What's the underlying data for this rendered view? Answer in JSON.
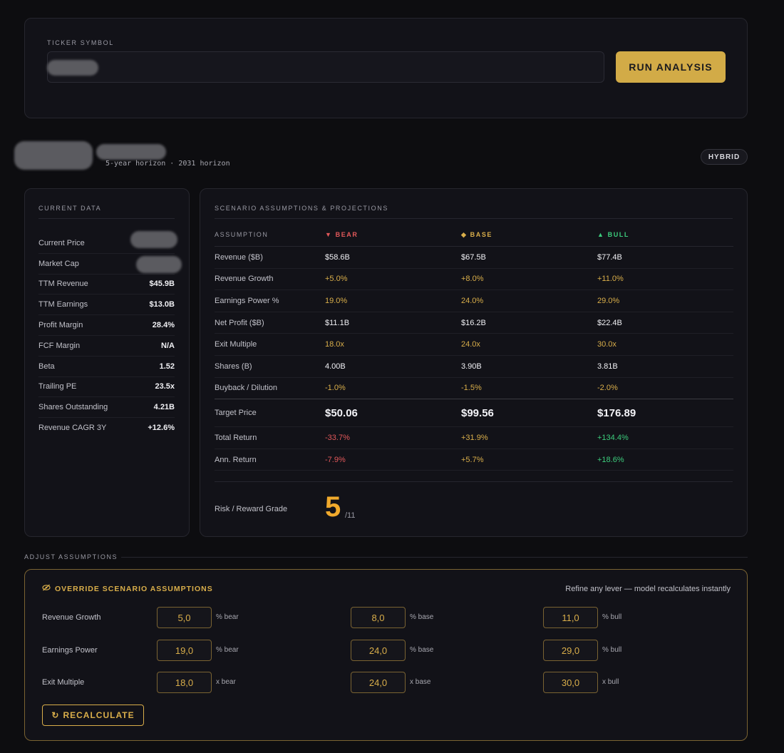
{
  "search": {
    "ticker_label": "TICKER SYMBOL",
    "ticker_value": "",
    "run_label": "RUN ANALYSIS"
  },
  "header": {
    "horizon": "5-year horizon · 2031 horizon",
    "mode_badge": "HYBRID"
  },
  "current_data": {
    "title": "CURRENT DATA",
    "rows": [
      {
        "label": "Current Price",
        "value": ""
      },
      {
        "label": "Market Cap",
        "value": ""
      },
      {
        "label": "TTM Revenue",
        "value": "$45.9B"
      },
      {
        "label": "TTM Earnings",
        "value": "$13.0B"
      },
      {
        "label": "Profit Margin",
        "value": "28.4%"
      },
      {
        "label": "FCF Margin",
        "value": "N/A"
      },
      {
        "label": "Beta",
        "value": "1.52"
      },
      {
        "label": "Trailing PE",
        "value": "23.5x"
      },
      {
        "label": "Shares Outstanding",
        "value": "4.21B"
      },
      {
        "label": "Revenue CAGR 3Y",
        "value": "+12.6%"
      }
    ]
  },
  "scenario": {
    "title": "SCENARIO ASSUMPTIONS & PROJECTIONS",
    "headers": {
      "assumption": "ASSUMPTION",
      "bear": "▼ BEAR",
      "base": "◆ BASE",
      "bull": "▲ BULL"
    },
    "rows": [
      {
        "label": "Revenue ($B)",
        "bear": "$58.6B",
        "base": "$67.5B",
        "bull": "$77.4B"
      },
      {
        "label": "Revenue Growth",
        "bear": "+5.0%",
        "base": "+8.0%",
        "bull": "+11.0%"
      },
      {
        "label": "Earnings Power %",
        "bear": "19.0%",
        "base": "24.0%",
        "bull": "29.0%"
      },
      {
        "label": "Net Profit ($B)",
        "bear": "$11.1B",
        "base": "$16.2B",
        "bull": "$22.4B"
      },
      {
        "label": "Exit Multiple",
        "bear": "18.0x",
        "base": "24.0x",
        "bull": "30.0x"
      },
      {
        "label": "Shares (B)",
        "bear": "4.00B",
        "base": "3.90B",
        "bull": "3.81B"
      },
      {
        "label": "Buyback / Dilution",
        "bear": "-1.0%",
        "base": "-1.5%",
        "bull": "-2.0%"
      }
    ],
    "target": {
      "label": "Target Price",
      "bear": "$50.06",
      "base": "$99.56",
      "bull": "$176.89"
    },
    "total_return": {
      "label": "Total Return",
      "bear": "-33.7%",
      "base": "+31.9%",
      "bull": "+134.4%"
    },
    "ann_return": {
      "label": "Ann. Return",
      "bear": "-7.9%",
      "base": "+5.7%",
      "bull": "+18.6%"
    },
    "grade_label": "Risk / Reward Grade",
    "grade_value": "5",
    "grade_max": "/11"
  },
  "adjust": {
    "section_label": "ADJUST ASSUMPTIONS",
    "title": "OVERRIDE SCENARIO ASSUMPTIONS",
    "subtitle": "Refine any lever — model recalculates instantly",
    "rows": [
      {
        "label": "Revenue Growth",
        "bear": "5,0",
        "base": "8,0",
        "bull": "11,0",
        "bear_unit": "% bear",
        "base_unit": "% base",
        "bull_unit": "% bull"
      },
      {
        "label": "Earnings Power",
        "bear": "19,0",
        "base": "24,0",
        "bull": "29,0",
        "bear_unit": "% bear",
        "base_unit": "% base",
        "bull_unit": "% bull"
      },
      {
        "label": "Exit Multiple",
        "bear": "18,0",
        "base": "24,0",
        "bull": "30,0",
        "bear_unit": "x bear",
        "base_unit": "x base",
        "bull_unit": "x bull"
      }
    ],
    "recalc_label": "RECALCULATE"
  }
}
